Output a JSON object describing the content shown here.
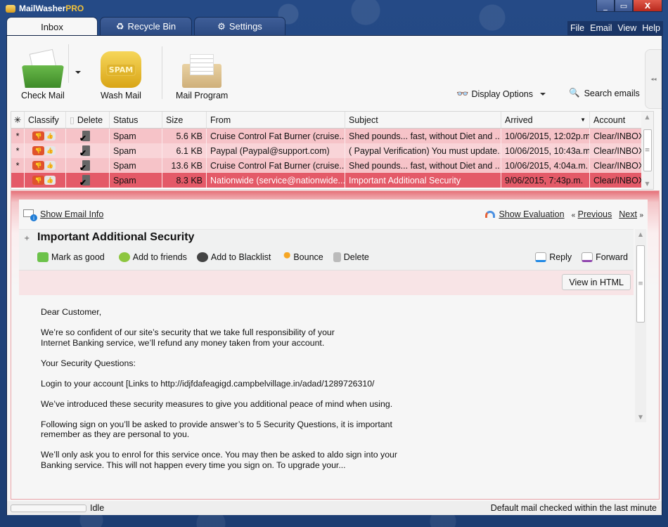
{
  "app": {
    "title_main": "MailWasher",
    "title_pro": "PRO",
    "window_buttons": {
      "minimize": "_",
      "maximize": "▭",
      "close": "X"
    }
  },
  "tabs": [
    {
      "label": "Inbox",
      "icon": "inbox",
      "active": true
    },
    {
      "label": "Recycle Bin",
      "icon": "recycle-icon",
      "active": false
    },
    {
      "label": "Settings",
      "icon": "gear-icon",
      "active": false
    }
  ],
  "menu": [
    "File",
    "Email",
    "View",
    "Help"
  ],
  "toolbar": {
    "check_mail": "Check Mail",
    "wash_mail": "Wash Mail",
    "wash_mail_badge": "SPAM",
    "mail_program": "Mail Program",
    "display_options": "Display Options",
    "search_emails": "Search emails",
    "collapse_handle": "◂◂"
  },
  "mail_list": {
    "columns": [
      "",
      "Classify",
      "Delete",
      "Status",
      "Size",
      "From",
      "Subject",
      "Arrived",
      "Account"
    ],
    "sort_column": "Arrived",
    "rows": [
      {
        "marker": "*",
        "status": "Spam",
        "size": "5.6 KB",
        "from": "Cruise Control Fat Burner (cruise...",
        "subject": "Shed pounds... fast, without Diet and ...",
        "arrived": "10/06/2015, 12:02p.m.",
        "account": "Clear/INBOX",
        "selected": false
      },
      {
        "marker": "*",
        "status": "Spam",
        "size": "6.1 KB",
        "from": "Paypal (Paypal@support.com)",
        "subject": "( Paypal Verification) You must update...",
        "arrived": "10/06/2015, 10:43a.m.",
        "account": "Clear/INBOX",
        "selected": false
      },
      {
        "marker": "*",
        "status": "Spam",
        "size": "13.6 KB",
        "from": "Cruise Control Fat Burner (cruise...",
        "subject": "Shed pounds... fast, without Diet and ...",
        "arrived": "10/06/2015, 4:04a.m.",
        "account": "Clear/INBOX",
        "selected": false
      },
      {
        "marker": "",
        "status": "Spam",
        "size": "8.3 KB",
        "from": "Nationwide (service@nationwide...",
        "subject": "Important Additional Security",
        "arrived": "9/06/2015, 7:43p.m.",
        "account": "Clear/INBOX",
        "selected": true
      }
    ]
  },
  "preview": {
    "show_email_info": "Show Email Info",
    "show_evaluation": "Show Evaluation",
    "previous": "Previous",
    "previous_prefix": "«",
    "next": "Next",
    "next_suffix": "»",
    "expander": "+",
    "subject": "Important Additional Security",
    "actions": {
      "mark_good": "Mark as good",
      "add_friends": "Add to friends",
      "add_blacklist": "Add to Blacklist",
      "bounce": "Bounce",
      "delete": "Delete",
      "reply": "Reply",
      "forward": "Forward"
    },
    "view_html": "View in HTML",
    "body": [
      "Dear Customer,",
      "We’re so confident of our site’s security that we take full responsibility of your\nInternet Banking service, we’ll refund any money taken from your account.",
      "Your Security Questions:",
      "Login to your account [Links to http://idjfdafeagigd.campbelvillage.in/adad/1289726310/",
      "We’ve introduced these security measures to give you additional peace of mind when using.",
      "Following sign on you’ll be asked to provide answer’s to 5 Security Questions, it is important\nremember as they are personal to you.",
      "We’ll only ask you to enrol for this service once. You may then be asked to aldo sign into your\nBanking service. This will not happen every time you sign on. To upgrade your..."
    ]
  },
  "statusbar": {
    "progress": 0,
    "state": "Idle",
    "message": "Default mail checked within the last minute"
  }
}
